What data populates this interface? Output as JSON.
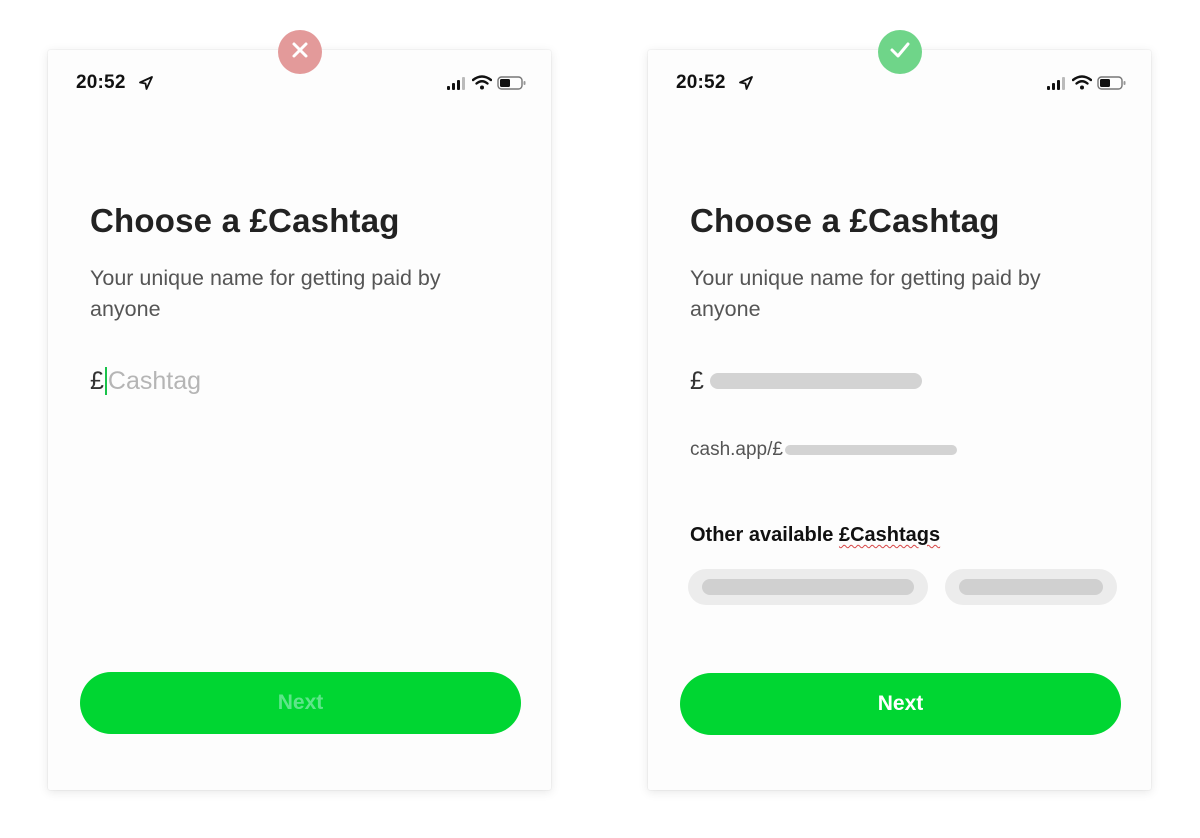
{
  "verdicts": {
    "bad": "close-icon",
    "good": "check-icon"
  },
  "colors": {
    "bad": "#e39a9a",
    "good": "#6fd589",
    "accent": "#00d632"
  },
  "phone_bad": {
    "time": "20:52",
    "title": "Choose a £Cashtag",
    "subtitle": "Your unique name for getting paid by anyone",
    "currency": "£",
    "placeholder": "Cashtag",
    "next_label": "Next"
  },
  "phone_good": {
    "time": "20:52",
    "title": "Choose a £Cashtag",
    "subtitle": "Your unique name for getting paid by anyone",
    "currency": "£",
    "url_prefix": "cash.app/£",
    "other_label_prefix": "Other available ",
    "other_label_word": "£Cashtags",
    "next_label": "Next"
  }
}
